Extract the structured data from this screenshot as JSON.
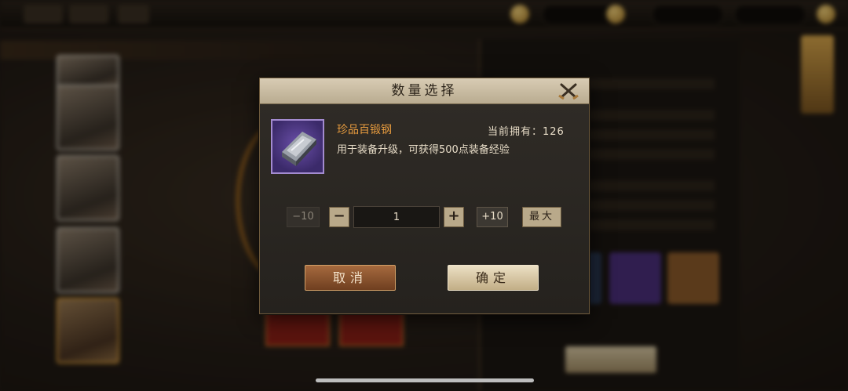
{
  "dialog": {
    "title": "数量选择",
    "item": {
      "name": "珍品百锻钢",
      "owned_label": "当前拥有：126",
      "description": "用于装备升级，可获得500点装备经验"
    },
    "quantity": {
      "minus10_label": "−10",
      "minus_label": "−",
      "value": "1",
      "plus_label": "+",
      "plus10_label": "+10",
      "max_label": "最大"
    },
    "cancel_label": "取消",
    "confirm_label": "确定"
  },
  "colors": {
    "item_name": "#e59a3e",
    "header_bg": "#d8ccb4",
    "cancel_bg": "#a66a3e",
    "confirm_bg": "#ece0c4",
    "item_frame": "#a38bd0"
  },
  "icons": {
    "close": "close-crossed-blades-icon",
    "item": "steel-ingot-icon"
  }
}
